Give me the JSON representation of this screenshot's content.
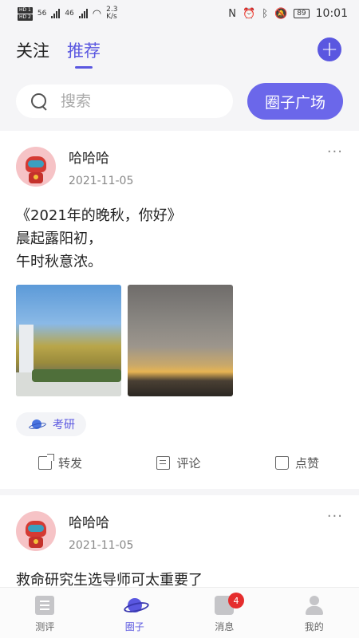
{
  "status_bar": {
    "network_speed": "2.3\nK/s",
    "network_speed_value": "2.3",
    "network_speed_unit": "K/s",
    "signal1": "56",
    "signal2": "46",
    "nfc": "N",
    "battery": "89",
    "time": "10:01"
  },
  "header": {
    "tabs": [
      {
        "label": "关注",
        "active": false
      },
      {
        "label": "推荐",
        "active": true
      }
    ],
    "add_icon": "plus-circle-icon"
  },
  "search": {
    "placeholder": "搜索",
    "plaza_button": "圈子广场"
  },
  "posts": [
    {
      "username": "哈哈哈",
      "date": "2021-11-05",
      "text": [
        "《2021年的晚秋，你好》",
        "晨起露阳初，",
        "午时秋意浓。"
      ],
      "images": [
        "trees-photo",
        "sunset-photo"
      ],
      "tag": "考研",
      "actions": {
        "share": "转发",
        "comment": "评论",
        "like": "点赞"
      }
    },
    {
      "username": "哈哈哈",
      "date": "2021-11-05",
      "text": [
        "救命研究生选导师可太重要了"
      ]
    }
  ],
  "bottom_nav": {
    "items": [
      {
        "label": "测评",
        "icon": "list-icon",
        "active": false
      },
      {
        "label": "圈子",
        "icon": "planet-icon",
        "active": true
      },
      {
        "label": "消息",
        "icon": "message-icon",
        "active": false,
        "badge": "4"
      },
      {
        "label": "我的",
        "icon": "user-icon",
        "active": false
      }
    ]
  },
  "colors": {
    "accent": "#5a57e0",
    "header_bg": "#f5f5f7",
    "badge": "#e52d2d"
  }
}
